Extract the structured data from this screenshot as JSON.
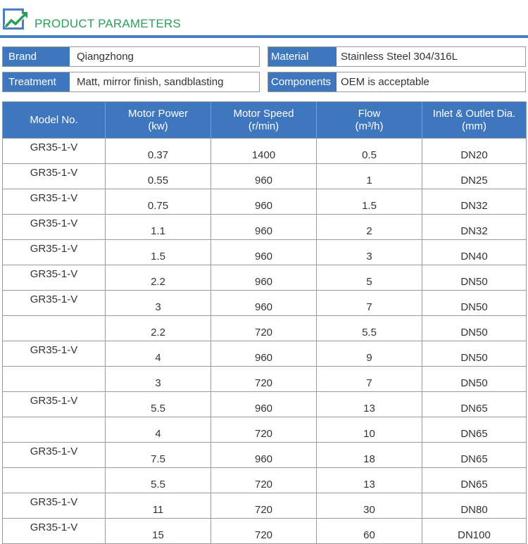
{
  "header": {
    "title": "PRODUCT PARAMETERS",
    "logo_icon": "chart-trend-logo-icon",
    "colors": {
      "title": "#2b9e5a",
      "accent": "#4a7fc1",
      "label_bg": "#3f77bf"
    }
  },
  "info": {
    "brand": {
      "label": "Brand",
      "value": "Qiangzhong"
    },
    "material": {
      "label": "Material",
      "value": "Stainless Steel 304/316L"
    },
    "treatment": {
      "label": "Treatment",
      "value": "Matt, mirror finish, sandblasting"
    },
    "components": {
      "label": "Components",
      "value": "OEM is acceptable"
    }
  },
  "table": {
    "headers": [
      [
        "Model No."
      ],
      [
        "Motor Power",
        "(kw)"
      ],
      [
        "Motor Speed",
        "(r/min)"
      ],
      [
        "Flow",
        "(m³/h)"
      ],
      [
        "Inlet & Outlet Dia.",
        "(mm)"
      ]
    ],
    "rows": [
      [
        "GR35-1-V",
        "0.37",
        "1400",
        "0.5",
        "DN20"
      ],
      [
        "GR35-1-V",
        "0.55",
        "960",
        "1",
        "DN25"
      ],
      [
        "GR35-1-V",
        "0.75",
        "960",
        "1.5",
        "DN32"
      ],
      [
        "GR35-1-V",
        "1.1",
        "960",
        "2",
        "DN32"
      ],
      [
        "GR35-1-V",
        "1.5",
        "960",
        "3",
        "DN40"
      ],
      [
        "GR35-1-V",
        "2.2",
        "960",
        "5",
        "DN50"
      ],
      [
        "GR35-1-V",
        "3",
        "960",
        "7",
        "DN50"
      ],
      [
        "",
        "2.2",
        "720",
        "5.5",
        "DN50"
      ],
      [
        "GR35-1-V",
        "4",
        "960",
        "9",
        "DN50"
      ],
      [
        "",
        "3",
        "720",
        "7",
        "DN50"
      ],
      [
        "GR35-1-V",
        "5.5",
        "960",
        "13",
        "DN65"
      ],
      [
        "",
        "4",
        "720",
        "10",
        "DN65"
      ],
      [
        "GR35-1-V",
        "7.5",
        "960",
        "18",
        "DN65"
      ],
      [
        "",
        "5.5",
        "720",
        "13",
        "DN65"
      ],
      [
        "GR35-1-V",
        "11",
        "720",
        "30",
        "DN80"
      ],
      [
        "GR35-1-V",
        "15",
        "720",
        "60",
        "DN100"
      ]
    ]
  }
}
